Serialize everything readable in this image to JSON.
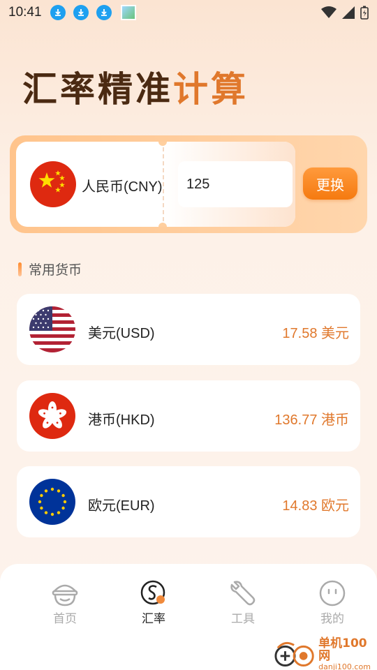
{
  "status_bar": {
    "time": "10:41"
  },
  "title": {
    "main": "汇率精准",
    "accent": "计算"
  },
  "converter": {
    "base_currency": "人民币(CNY)",
    "amount": "125",
    "swap_label": "更换"
  },
  "section": {
    "title": "常用货币"
  },
  "currencies": [
    {
      "name": "美元(USD)",
      "value": "17.58 美元",
      "flag_icon": "us-flag-icon"
    },
    {
      "name": "港币(HKD)",
      "value": "136.77 港币",
      "flag_icon": "hk-flag-icon"
    },
    {
      "name": "欧元(EUR)",
      "value": "14.83 欧元",
      "flag_icon": "eu-flag-icon"
    }
  ],
  "nav": [
    {
      "label": "首页",
      "icon": "home-face-icon",
      "active": false
    },
    {
      "label": "汇率",
      "icon": "exchange-rate-icon",
      "active": true
    },
    {
      "label": "工具",
      "icon": "wrench-icon",
      "active": false
    },
    {
      "label": "我的",
      "icon": "profile-face-icon",
      "active": false
    }
  ],
  "watermark": {
    "main": "单机100网",
    "sub": "danji100.com"
  },
  "colors": {
    "accent": "#e0782c",
    "button": "#f57a10",
    "title": "#4b2a12"
  }
}
